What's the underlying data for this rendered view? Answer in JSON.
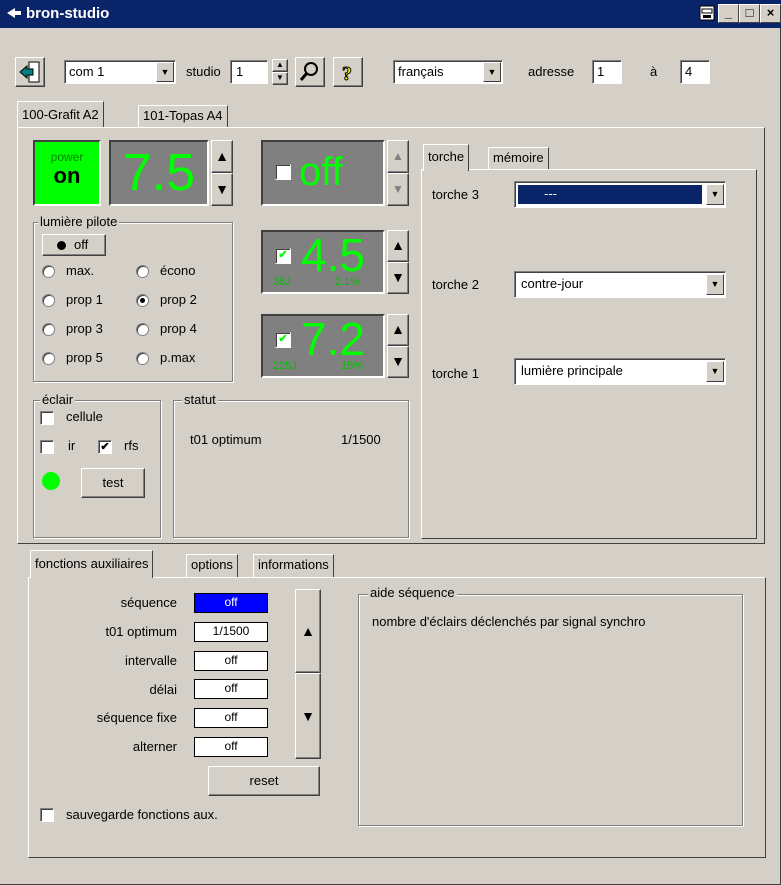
{
  "window": {
    "title": "bron-studio"
  },
  "toolbar": {
    "port": "com 1",
    "studio_label": "studio",
    "studio_value": "1",
    "language": "français",
    "adresse_label": "adresse",
    "adresse_from": "1",
    "a_label": "à",
    "adresse_to": "4"
  },
  "device_tabs": [
    "100-Grafit A2",
    "101-Topas A4"
  ],
  "power": {
    "label": "power",
    "state": "on",
    "value": "7.5"
  },
  "pilot": {
    "legend": "lumière pilote",
    "toggle_label": "off",
    "options": [
      "max.",
      "écono",
      "prop 1",
      "prop 2",
      "prop 3",
      "prop 4",
      "prop 5",
      "p.max"
    ],
    "selected": "prop 2"
  },
  "flash_heads": [
    {
      "value": "off",
      "checked": false,
      "energy": "",
      "percent": ""
    },
    {
      "value": "4.5",
      "checked": true,
      "energy": "35J",
      "percent": "2.1%"
    },
    {
      "value": "7.2",
      "checked": true,
      "energy": "225J",
      "percent": "15%"
    }
  ],
  "eclair": {
    "legend": "éclair",
    "cellule": "cellule",
    "ir": "ir",
    "rfs": "rfs",
    "test": "test"
  },
  "statut": {
    "legend": "statut",
    "name": "t01 optimum",
    "value": "1/1500"
  },
  "right_tabs": [
    "torche",
    "mémoire"
  ],
  "torches": [
    {
      "label": "torche 3",
      "value": "---"
    },
    {
      "label": "torche 2",
      "value": "contre-jour"
    },
    {
      "label": "torche 1",
      "value": "lumière principale"
    }
  ],
  "bottom_tabs": [
    "fonctions auxiliaires",
    "options",
    "informations"
  ],
  "aux": [
    {
      "label": "séquence",
      "value": "off"
    },
    {
      "label": "t01 optimum",
      "value": "1/1500"
    },
    {
      "label": "intervalle",
      "value": "off"
    },
    {
      "label": "délai",
      "value": "off"
    },
    {
      "label": "séquence fixe",
      "value": "off"
    },
    {
      "label": "alterner",
      "value": "off"
    }
  ],
  "reset_label": "reset",
  "save_label": "sauvegarde fonctions aux.",
  "aide": {
    "legend": "aide séquence",
    "text": "nombre d'éclairs déclenchés par signal synchro"
  },
  "colors": {
    "lcd_text": "#00ff00",
    "power_bg": "#00ff00",
    "selection": "#0a246a",
    "titlebar": "#0a246a"
  }
}
